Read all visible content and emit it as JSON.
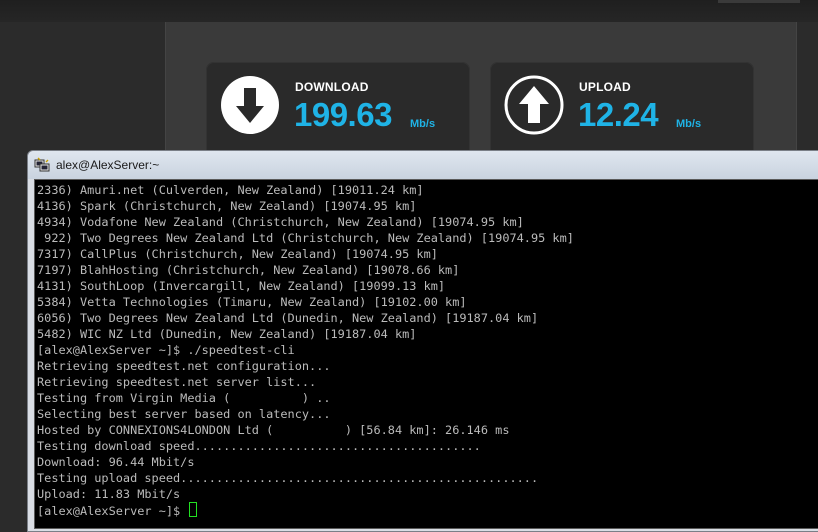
{
  "speedtest": {
    "download": {
      "label": "DOWNLOAD",
      "value": "199.63",
      "unit": "Mb/s",
      "icon": "download-arrow-icon"
    },
    "upload": {
      "label": "UPLOAD",
      "value": "12.24",
      "unit": "Mb/s",
      "icon": "upload-arrow-icon"
    },
    "accent_color": "#1fb3e6"
  },
  "terminal": {
    "window_title": "alex@AlexServer:~",
    "lines": [
      "2336) Amuri.net (Culverden, New Zealand) [19011.24 km]",
      "4136) Spark (Christchurch, New Zealand) [19074.95 km]",
      "4934) Vodafone New Zealand (Christchurch, New Zealand) [19074.95 km]",
      " 922) Two Degrees New Zealand Ltd (Christchurch, New Zealand) [19074.95 km]",
      "7317) CallPlus (Christchurch, New Zealand) [19074.95 km]",
      "7197) BlahHosting (Christchurch, New Zealand) [19078.66 km]",
      "4131) SouthLoop (Invercargill, New Zealand) [19099.13 km]",
      "5384) Vetta Technologies (Timaru, New Zealand) [19102.00 km]",
      "6056) Two Degrees New Zealand Ltd (Dunedin, New Zealand) [19187.04 km]",
      "5482) WIC NZ Ltd (Dunedin, New Zealand) [19187.04 km]",
      "[alex@AlexServer ~]$ ./speedtest-cli",
      "Retrieving speedtest.net configuration...",
      "Retrieving speedtest.net server list...",
      "Testing from Virgin Media (          ) ..",
      "Selecting best server based on latency...",
      "Hosted by CONNEXIONS4LONDON Ltd (          ) [56.84 km]: 26.146 ms",
      "Testing download speed........................................",
      "Download: 96.44 Mbit/s",
      "Testing upload speed..................................................",
      "Upload: 11.83 Mbit/s"
    ],
    "prompt": "[alex@AlexServer ~]$ ",
    "text_color": "#bbbbbb",
    "cursor_color": "#22e022"
  }
}
